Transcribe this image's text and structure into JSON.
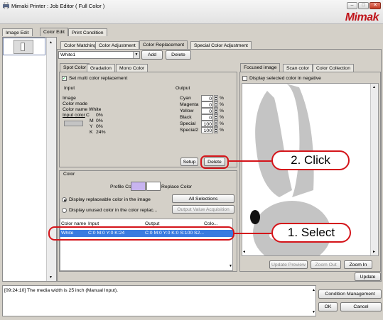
{
  "window": {
    "title": "Mimaki Printer : Job Editor ( Full Color )",
    "logo": "Mimak"
  },
  "main_tabs": [
    "Image Edit",
    "Color Edit",
    "Print Condition"
  ],
  "color_tabs": [
    "Color Matching",
    "Color Adjustment",
    "Color Replacement",
    "Special Color Adjustment"
  ],
  "color_select": {
    "value": "White1",
    "add": "Add",
    "delete": "Delete"
  },
  "spot_tabs": [
    "Spot Color",
    "Gradation",
    "Mono Color"
  ],
  "multi_replace": "Set multi color replacement",
  "input": {
    "header": "Input",
    "image": "Image",
    "color_mode": "Color mode",
    "color_name": "Color name White",
    "input_color": "Input color",
    "c": "C",
    "c_val": "0%",
    "m": "M",
    "m_val": "0%",
    "y": "Y",
    "y_val": "0%",
    "k": "K",
    "k_val": "24%"
  },
  "output": {
    "header": "Output",
    "rows": [
      {
        "label": "Cyan",
        "value": "0"
      },
      {
        "label": "Magenta",
        "value": "0"
      },
      {
        "label": "Yellow",
        "value": "0"
      },
      {
        "label": "Black",
        "value": "0"
      },
      {
        "label": "Special",
        "value": "100"
      },
      {
        "label": "Special2",
        "value": "100"
      }
    ],
    "unit": "%"
  },
  "setup": "Setup",
  "delete2": "Delete",
  "color": {
    "header": "Color",
    "profile": "Profile Color",
    "replace": "Replace Color",
    "opt1": "Display replaceable color in the image",
    "opt2": "Display unused color in the color replac...",
    "all_sel": "All Selections",
    "out_val": "Output Value Acquisition"
  },
  "table": {
    "headers": [
      "Color name",
      "Input",
      "Output",
      "Colo..."
    ],
    "row": [
      "White",
      "C:0 M:0 Y:0 K:24",
      "C:0 M:0 Y:0 K:0 S:100 S2..."
    ]
  },
  "preview_tabs": [
    "Focused image",
    "Scan color",
    "Color Collection"
  ],
  "negative": "Display selected color in negative",
  "preview_btns": {
    "update_preview": "Update Preview",
    "zoom_out": "Zoom Out",
    "zoom_in": "Zoom In",
    "update": "Update"
  },
  "log": "[09:24:10] The media width is 25 inch (Manual Input).",
  "bottom": {
    "cond": "Condition Management",
    "ok": "OK",
    "cancel": "Cancel"
  },
  "callouts": {
    "click": "2. Click",
    "select": "1. Select"
  }
}
